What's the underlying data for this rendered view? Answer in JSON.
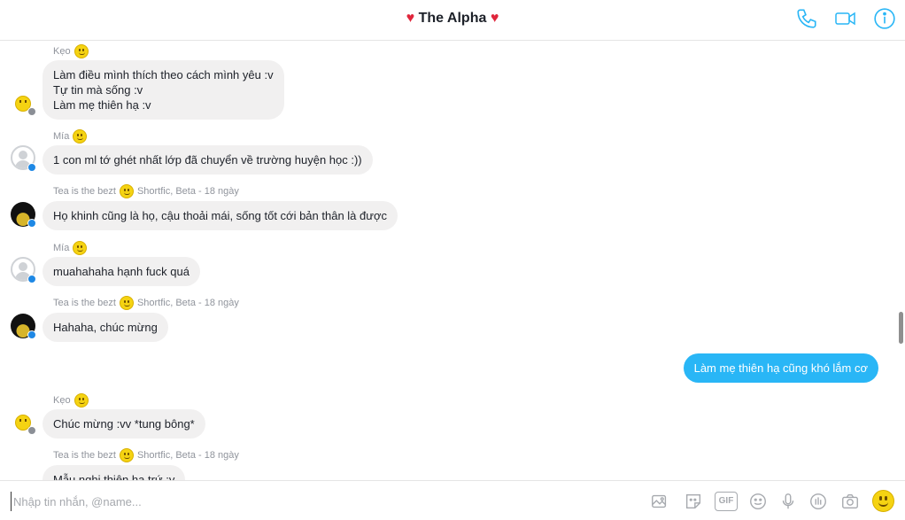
{
  "header": {
    "title": "The Alpha",
    "heart_glyph": "♥",
    "accent_color": "#29b6f6",
    "icons": [
      "phone-icon",
      "video-call-icon",
      "info-icon"
    ]
  },
  "messages": [
    {
      "sender": "Kẹo",
      "avatar": "smiley-avatar",
      "lines": [
        "Làm điều mình thích theo cách mình yêu :v",
        "Tự tin mà sống :v",
        "Làm mẹ thiên hạ :v"
      ]
    },
    {
      "sender": "Mía",
      "avatar": "default-avatar",
      "lines": [
        "1 con ml tớ ghét nhất lớp đã chuyển về trường huyện học :))"
      ]
    },
    {
      "sender": "Tea is the bezt",
      "sender_meta": "Shortfic, Beta - 18 ngày",
      "avatar": "user-avatar",
      "lines": [
        "Họ khinh cũng là họ, cậu thoải mái, sống tốt cới bản thân là được"
      ]
    },
    {
      "sender": "Mía",
      "avatar": "default-avatar",
      "lines": [
        "muahahaha hạnh fuck quá"
      ]
    },
    {
      "sender": "Tea is the bezt",
      "sender_meta": "Shortfic, Beta - 18 ngày",
      "avatar": "user-avatar",
      "lines": [
        "Hahaha, chúc mừng"
      ]
    },
    {
      "outgoing": true,
      "lines": [
        "Làm mẹ thiên hạ cũng khó lắm cơ"
      ]
    },
    {
      "sender": "Kẹo",
      "avatar": "smiley-avatar",
      "lines": [
        "Chúc mừng :vv *tung bông*"
      ]
    },
    {
      "sender": "Tea is the bezt",
      "sender_meta": "Shortfic, Beta - 18 ngày",
      "avatar": "user-avatar",
      "lines": [
        "Mẫu nghi thiên hạ trứ :v"
      ]
    }
  ],
  "composer": {
    "placeholder": "Nhập tin nhắn, @name...",
    "value": "",
    "gif_label": "GIF",
    "icons": [
      "photo-icon",
      "sticker-icon",
      "gif-icon",
      "emoji-icon",
      "microphone-icon",
      "poll-icon",
      "camera-icon",
      "like-emoji-icon"
    ]
  }
}
